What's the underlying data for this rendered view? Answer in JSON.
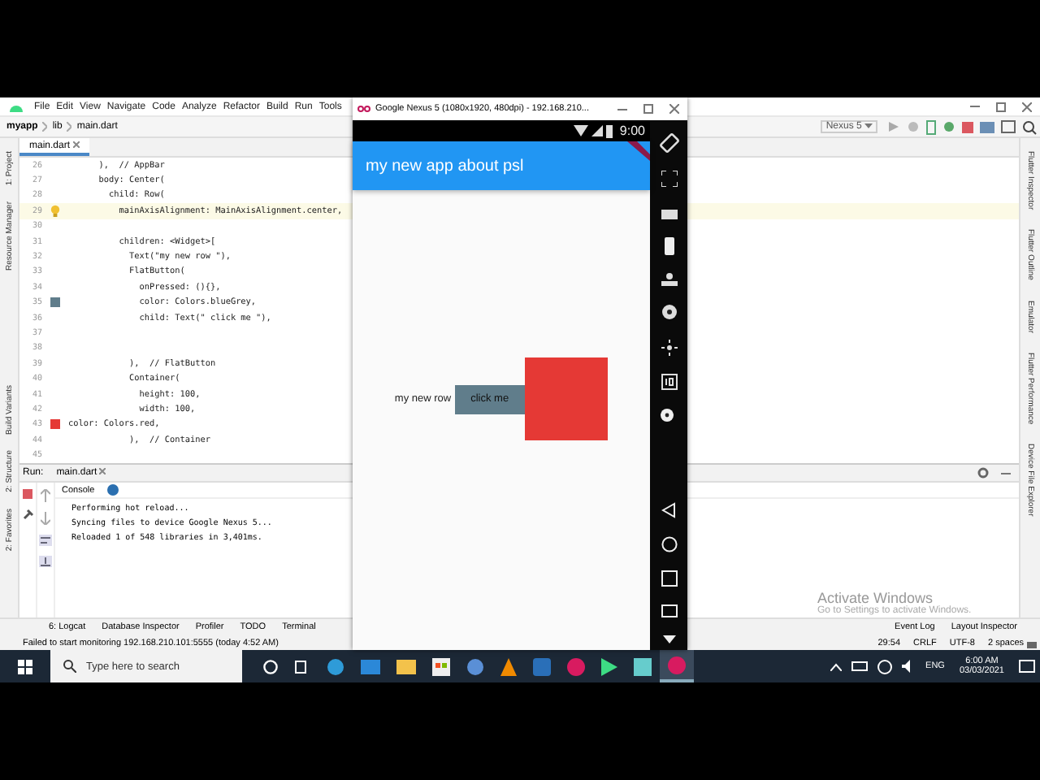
{
  "ide": {
    "menu": [
      "File",
      "Edit",
      "View",
      "Navigate",
      "Code",
      "Analyze",
      "Refactor",
      "Build",
      "Run",
      "Tools"
    ],
    "breadcrumb": [
      "myapp",
      "lib",
      "main.dart"
    ],
    "device_selector": "Nexus 5",
    "editor_tab": "main.dart",
    "left_tools": [
      "1: Project",
      "Resource Manager",
      "Build Variants",
      "2: Structure",
      "2: Favorites"
    ],
    "right_tools": [
      "Flutter Inspector",
      "Flutter Outline",
      "Emulator",
      "Flutter Performance",
      "Device File Explorer"
    ],
    "code_lines": [
      {
        "num": "26",
        "text": "      ),  // AppBar",
        "current": false
      },
      {
        "num": "27",
        "text": "      body: Center(",
        "current": false
      },
      {
        "num": "28",
        "text": "        child: Row(",
        "current": false
      },
      {
        "num": "29",
        "text": "          mainAxisAlignment: MainAxisAlignment.center,",
        "current": true,
        "marker": {
          "kind": "bulb"
        }
      },
      {
        "num": "30",
        "current": false
      },
      {
        "num": "31",
        "text": "          children: <Widget>[",
        "current": false
      },
      {
        "num": "32",
        "text": "            Text(\"my new row \"),",
        "current": false
      },
      {
        "num": "33",
        "text": "            FlatButton(",
        "current": false
      },
      {
        "num": "34",
        "text": "              onPressed: (){},",
        "current": false
      },
      {
        "num": "35",
        "text": "              color: Colors.blueGrey,",
        "current": false,
        "marker": {
          "kind": "swatch",
          "color": "#607d8b"
        }
      },
      {
        "num": "36",
        "text": "              child: Text(\" click me \"),",
        "current": false
      },
      {
        "num": "37",
        "current": false
      },
      {
        "num": "38",
        "current": false
      },
      {
        "num": "39",
        "text": "            ),  // FlatButton",
        "current": false
      },
      {
        "num": "40",
        "text": "            Container(",
        "current": false
      },
      {
        "num": "41",
        "text": "              height: 100,",
        "current": false
      },
      {
        "num": "42",
        "text": "              width: 100,",
        "current": false
      },
      {
        "num": "43",
        "text": "color: Colors.red,",
        "current": false,
        "marker": {
          "kind": "swatch",
          "color": "#e53935"
        }
      },
      {
        "num": "44",
        "text": "            ),  // Container",
        "current": false
      },
      {
        "num": "45",
        "current": false
      }
    ],
    "run_panel": {
      "label": "Run:",
      "tab": "main.dart",
      "console_tab": "Console",
      "output": [
        "Performing hot reload...",
        "Syncing files to device Google Nexus 5...",
        "Reloaded 1 of 548 libraries in 3,401ms."
      ]
    },
    "bottom_tools": [
      "6: Logcat",
      "Database Inspector",
      "Profiler",
      "TODO",
      "Terminal"
    ],
    "bottom_tools_right": [
      "Event Log",
      "Layout Inspector"
    ],
    "status_bar": {
      "message": "Failed to start monitoring 192.168.210.101:5555 (today 4:52 AM)",
      "items": [
        "29:54",
        "CRLF",
        "UTF-8",
        "2 spaces"
      ]
    }
  },
  "emulator": {
    "title": "Google Nexus 5 (1080x1920, 480dpi) - 192.168.210...",
    "clock": "9:00",
    "app_title": "my new app about psl",
    "row_text": "my new row",
    "button_label": "click me"
  },
  "activation": {
    "title": "Activate Windows",
    "message": "Go to Settings to activate Windows."
  },
  "taskbar": {
    "search_placeholder": "Type here to search",
    "language": "ENG",
    "time": "6:00 AM",
    "date": "03/03/2021"
  }
}
